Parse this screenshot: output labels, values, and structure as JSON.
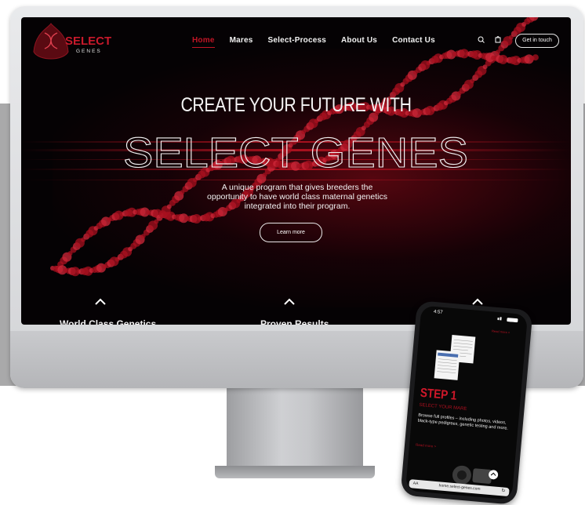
{
  "site": {
    "logo_main": "SELECT",
    "logo_sub": "GENES",
    "nav": [
      "Home",
      "Mares",
      "Select-Process",
      "About Us",
      "Contact Us"
    ],
    "active_nav": "Home",
    "cta_button": "Get in touch",
    "icons": [
      "search-icon",
      "bag-icon"
    ]
  },
  "hero": {
    "headline": "CREATE YOUR FUTURE WITH",
    "big_title": "SELECT GENES",
    "subtitle": "A unique program that gives breeders the opportunity to have world class maternal genetics integrated into their program.",
    "learn_more": "Learn more"
  },
  "features": [
    {
      "title": "World Class Genetics",
      "icon": "chevron-up-icon"
    },
    {
      "title": "Proven Results",
      "icon": "chevron-up-icon"
    },
    {
      "title": "",
      "icon": "chevron-up-icon"
    }
  ],
  "phone": {
    "time": "4:57",
    "read_more_top": "Read more >",
    "step_title": "STEP 1",
    "step_subtitle": "SELECT YOUR MARE",
    "step_desc": "Browse full profiles – including photos, videos, black-type pedigrees, genetic testing and more.",
    "read_more": "Read more >",
    "url_prefix": "AA",
    "url": "home.select-genes.com"
  },
  "colors": {
    "accent": "#c01525",
    "background": "#050204"
  }
}
